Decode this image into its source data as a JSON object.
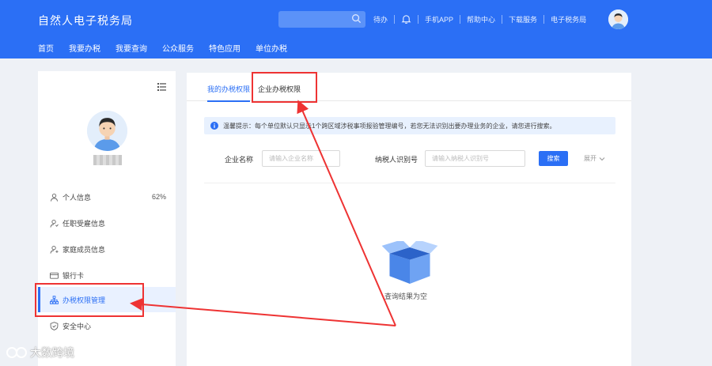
{
  "header": {
    "title": "自然人电子税务局",
    "links": [
      "待办",
      "手机APP",
      "帮助中心",
      "下载服务",
      "电子税务局"
    ]
  },
  "nav": [
    "首页",
    "我要办税",
    "我要查询",
    "公众服务",
    "特色应用",
    "单位办税"
  ],
  "sidebar": {
    "items": [
      {
        "label": "个人信息",
        "badge": "62%",
        "icon": "user-icon"
      },
      {
        "label": "任职受雇信息",
        "icon": "user-work-icon"
      },
      {
        "label": "家庭成员信息",
        "icon": "family-icon"
      },
      {
        "label": "银行卡",
        "icon": "bank-card-icon"
      },
      {
        "label": "办税权限管理",
        "icon": "org-tree-icon"
      },
      {
        "label": "安全中心",
        "icon": "shield-icon"
      }
    ]
  },
  "main": {
    "tabs": [
      "我的办税权限",
      "企业办税权限"
    ],
    "tip": "温馨提示：每个单位默认只显示1个跨区域涉税事项报验管理编号，若您无法识别出要办理业务的企业，请您进行搜索。",
    "form": {
      "company_label": "企业名称",
      "company_placeholder": "请输入企业名称",
      "taxid_label": "纳税人识别号",
      "taxid_placeholder": "请输入纳税人识别号",
      "search_button": "搜索",
      "expand_label": "展开"
    },
    "empty_text": "查询结果为空"
  },
  "watermark": "大数跨境",
  "colors": {
    "primary": "#2b6ff5",
    "annotation": "#e33333"
  }
}
